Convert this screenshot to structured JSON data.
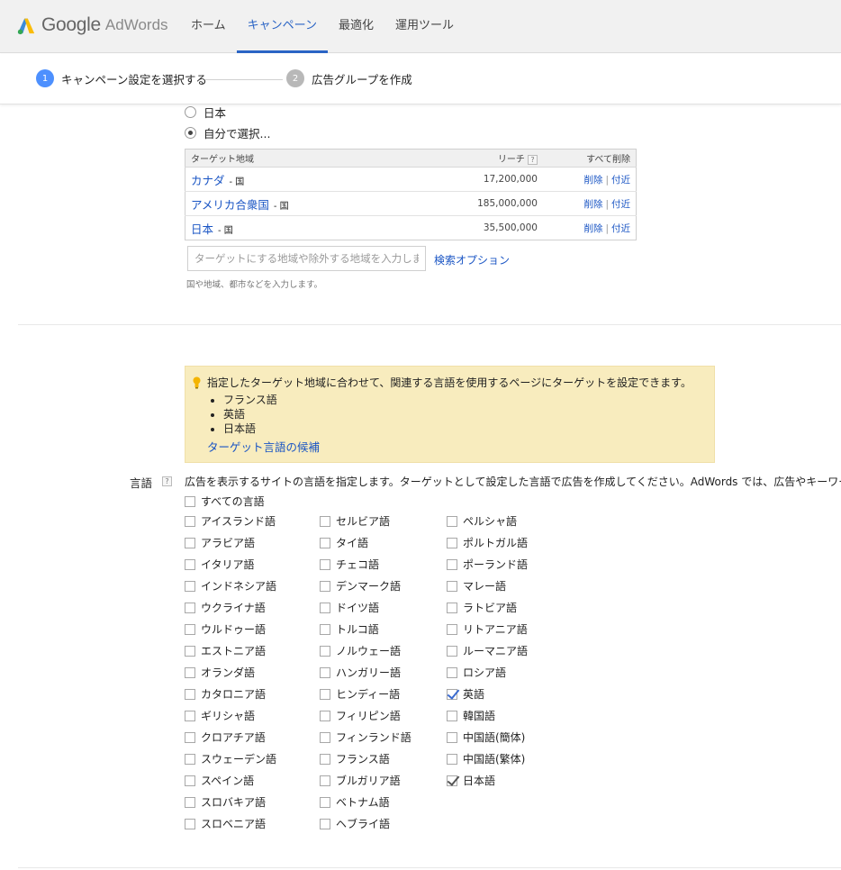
{
  "header": {
    "logo_google": "Google",
    "logo_adwords": "AdWords",
    "tabs": [
      {
        "label": "ホーム",
        "active": false
      },
      {
        "label": "キャンペーン",
        "active": true
      },
      {
        "label": "最適化",
        "active": false
      },
      {
        "label": "運用ツール",
        "active": false
      }
    ]
  },
  "stepper": {
    "steps": [
      {
        "num": "1",
        "label": "キャンペーン設定を選択する",
        "active": true
      },
      {
        "num": "2",
        "label": "広告グループを作成",
        "active": false
      }
    ]
  },
  "location": {
    "radio_options": [
      {
        "label": "日本",
        "checked": false
      },
      {
        "label": "自分で選択...",
        "checked": true
      }
    ],
    "table": {
      "col_target": "ターゲット地域",
      "col_reach": "リーチ",
      "reach_help": "?",
      "remove_all": "すべて削除",
      "rows": [
        {
          "name": "カナダ",
          "type": "- 国",
          "reach": "17,200,000",
          "remove": "削除",
          "nearby": "付近"
        },
        {
          "name": "アメリカ合衆国",
          "type": "- 国",
          "reach": "185,000,000",
          "remove": "削除",
          "nearby": "付近"
        },
        {
          "name": "日本",
          "type": "- 国",
          "reach": "35,500,000",
          "remove": "削除",
          "nearby": "付近"
        }
      ]
    },
    "search_placeholder": "ターゲットにする地域や除外する地域を入力します",
    "search_options": "検索オプション",
    "hint": "国や地域、都市などを入力します。"
  },
  "info_box": {
    "message": "指定したターゲット地域に合わせて、関連する言語を使用するページにターゲットを設定できます。",
    "languages": [
      "フランス語",
      "英語",
      "日本語"
    ],
    "link": "ターゲット言語の候補"
  },
  "language": {
    "label": "言語",
    "help": "?",
    "description": "広告を表示するサイトの言語を指定します。ターゲットとして設定した言語で広告を作成してください。AdWords では、広告やキーワード A",
    "all": {
      "label": "すべての言語",
      "checked": false
    },
    "columns": [
      [
        {
          "label": "アイスランド語",
          "checked": false
        },
        {
          "label": "アラビア語",
          "checked": false
        },
        {
          "label": "イタリア語",
          "checked": false
        },
        {
          "label": "インドネシア語",
          "checked": false
        },
        {
          "label": "ウクライナ語",
          "checked": false
        },
        {
          "label": "ウルドゥー語",
          "checked": false
        },
        {
          "label": "エストニア語",
          "checked": false
        },
        {
          "label": "オランダ語",
          "checked": false
        },
        {
          "label": "カタロニア語",
          "checked": false
        },
        {
          "label": "ギリシャ語",
          "checked": false
        },
        {
          "label": "クロアチア語",
          "checked": false
        },
        {
          "label": "スウェーデン語",
          "checked": false
        },
        {
          "label": "スペイン語",
          "checked": false
        },
        {
          "label": "スロバキア語",
          "checked": false
        },
        {
          "label": "スロベニア語",
          "checked": false
        }
      ],
      [
        {
          "label": "セルビア語",
          "checked": false
        },
        {
          "label": "タイ語",
          "checked": false
        },
        {
          "label": "チェコ語",
          "checked": false
        },
        {
          "label": "デンマーク語",
          "checked": false
        },
        {
          "label": "ドイツ語",
          "checked": false
        },
        {
          "label": "トルコ語",
          "checked": false
        },
        {
          "label": "ノルウェー語",
          "checked": false
        },
        {
          "label": "ハンガリー語",
          "checked": false
        },
        {
          "label": "ヒンディー語",
          "checked": false
        },
        {
          "label": "フィリピン語",
          "checked": false
        },
        {
          "label": "フィンランド語",
          "checked": false
        },
        {
          "label": "フランス語",
          "checked": false
        },
        {
          "label": "ブルガリア語",
          "checked": false
        },
        {
          "label": "ベトナム語",
          "checked": false
        },
        {
          "label": "ヘブライ語",
          "checked": false
        }
      ],
      [
        {
          "label": "ペルシャ語",
          "checked": false
        },
        {
          "label": "ポルトガル語",
          "checked": false
        },
        {
          "label": "ポーランド語",
          "checked": false
        },
        {
          "label": "マレー語",
          "checked": false
        },
        {
          "label": "ラトビア語",
          "checked": false
        },
        {
          "label": "リトアニア語",
          "checked": false
        },
        {
          "label": "ルーマニア語",
          "checked": false
        },
        {
          "label": "ロシア語",
          "checked": false
        },
        {
          "label": "英語",
          "checked": true
        },
        {
          "label": "韓国語",
          "checked": false
        },
        {
          "label": "中国語(簡体)",
          "checked": false
        },
        {
          "label": "中国語(繁体)",
          "checked": false
        },
        {
          "label": "日本語",
          "checked": true
        }
      ]
    ]
  },
  "colors": {
    "accent": "#2a64c5",
    "link": "#1a55c4",
    "info_bg": "#f8ecbe",
    "step_active": "#4d90fe"
  }
}
